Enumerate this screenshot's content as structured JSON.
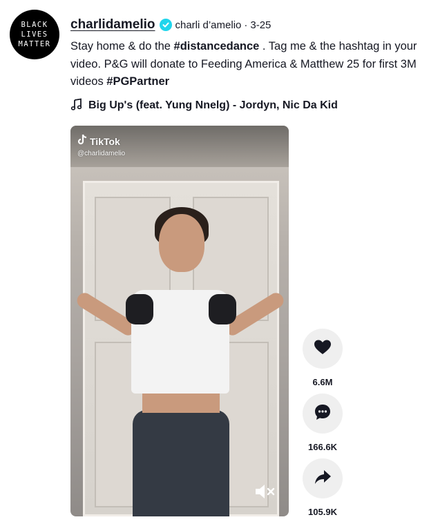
{
  "avatar": {
    "lines": [
      "BLACK",
      "LIVES",
      "MATTER"
    ]
  },
  "post": {
    "username": "charlidamelio",
    "nickname": "charli d’amelio",
    "separator": "·",
    "date": "3-25",
    "caption": {
      "part1": "Stay home & do the ",
      "hashtag1": "#distancedance",
      "part2": " . Tag me & the hashtag in your video. P&G will donate to Feeding America & Matthew 25 for first 3M videos ",
      "hashtag2": "#PGPartner"
    },
    "music": "Big Up's (feat. Yung Nnelg) - Jordyn, Nic Da Kid"
  },
  "video": {
    "watermark_logo": "TikTok",
    "watermark_handle": "@charlidamelio"
  },
  "actions": [
    {
      "icon": "heart-icon",
      "count": "6.6M"
    },
    {
      "icon": "comment-icon",
      "count": "166.6K"
    },
    {
      "icon": "share-icon",
      "count": "105.9K"
    }
  ],
  "colors": {
    "verified": "#20d5ec",
    "text": "#161823",
    "action_bg": "#efefef"
  }
}
